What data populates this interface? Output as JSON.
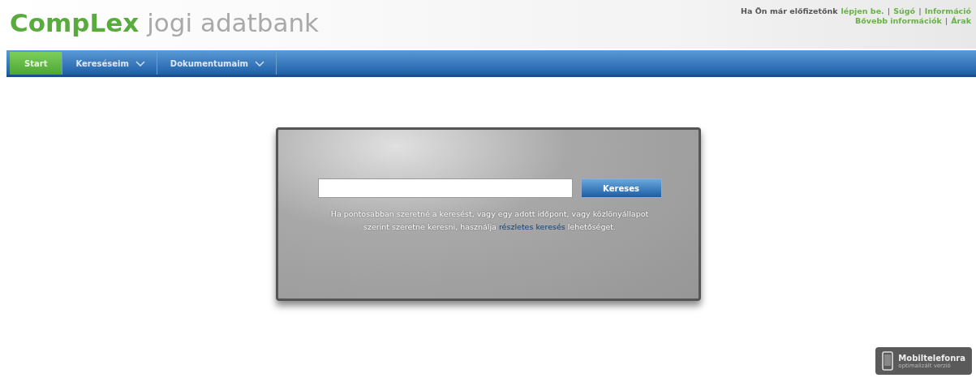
{
  "logo": {
    "brand": "CompLex",
    "subtitle": "jogi adatbank"
  },
  "account": {
    "prompt": "Ha Ön már előfizetőnk",
    "line1": [
      {
        "kind": "link",
        "text": "lépjen be."
      },
      {
        "kind": "separator",
        "text": "|"
      },
      {
        "kind": "link",
        "text": "Súgó"
      },
      {
        "kind": "separator",
        "text": "|"
      },
      {
        "kind": "link",
        "text": "Információ"
      }
    ],
    "line2": [
      {
        "kind": "link",
        "text": "Bővebb információk"
      },
      {
        "kind": "separator",
        "text": "|"
      },
      {
        "kind": "link",
        "text": "Árak"
      }
    ]
  },
  "tabs": [
    {
      "label": "Start",
      "selected": true,
      "has_menu": false
    },
    {
      "label": "Kereséseim",
      "selected": false,
      "has_menu": true
    },
    {
      "label": "Dokumentumaim",
      "selected": false,
      "has_menu": true
    }
  ],
  "search": {
    "button": "Kereses",
    "hint_before": "Ha pontosabban szeretné a keresést, vagy egy adott időpont, vagy közlönyállapot szerint szeretne keresni, használja ",
    "hint_link": "részletes keresés",
    "hint_after": " lehetőséget."
  },
  "mobile_badge": {
    "title": "Mobiltelefonra",
    "subtitle": "optimalizált verzió"
  }
}
